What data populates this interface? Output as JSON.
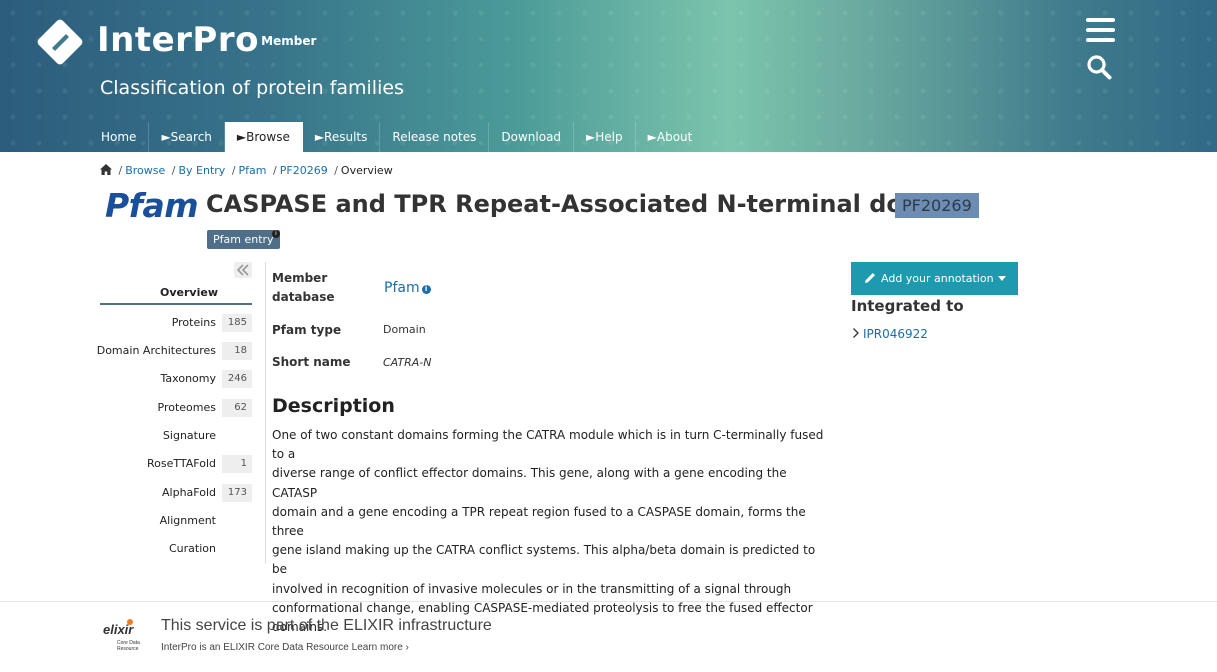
{
  "header": {
    "logo_text": "InterPro",
    "logo_sub": "- Member",
    "tagline": "Classification of protein families",
    "menu_icon": "hamburger-menu-icon",
    "search_icon": "search-icon"
  },
  "nav": {
    "items": [
      {
        "label": "Home"
      },
      {
        "label": "►Search"
      },
      {
        "label": "►Browse",
        "active": true
      },
      {
        "label": "►Results"
      },
      {
        "label": "Release notes"
      },
      {
        "label": "Download"
      },
      {
        "label": "►Help"
      },
      {
        "label": "►About"
      }
    ]
  },
  "breadcrumb": {
    "home_icon": "home-icon",
    "items": [
      "Browse",
      "By Entry",
      "Pfam",
      "PF20269"
    ],
    "current": "Overview"
  },
  "entry": {
    "db_logo": "Pfam",
    "title": "CASPASE and TPR Repeat-Associated N-terminal domain",
    "accession": "PF20269",
    "tag": "Pfam entry",
    "tag_info": "i"
  },
  "sidebar": {
    "overview": "Overview",
    "items": [
      {
        "label": "Proteins",
        "count": "185"
      },
      {
        "label": "Domain Architectures",
        "count": "18"
      },
      {
        "label": "Taxonomy",
        "count": "246"
      },
      {
        "label": "Proteomes",
        "count": "62"
      },
      {
        "label": "Signature",
        "count": ""
      },
      {
        "label": "RoseTTAFold",
        "count": "1"
      },
      {
        "label": "AlphaFold",
        "count": "173"
      },
      {
        "label": "Alignment",
        "count": ""
      },
      {
        "label": "Curation",
        "count": ""
      }
    ]
  },
  "details": {
    "member_db_label_1": "Member",
    "member_db_label_2": "database",
    "member_db_value": "Pfam",
    "member_db_info": "i",
    "type_label": "Pfam type",
    "type_value": "Domain",
    "short_name_label": "Short name",
    "short_name_value": "CATRA-N"
  },
  "description": {
    "heading": "Description",
    "lines": [
      "One of two constant domains forming the CATRA module which is in turn C-terminally fused to a",
      "diverse range of conflict effector domains. This gene, along with a gene encoding the CATASP",
      "domain and a gene encoding a TPR repeat region fused to a CASPASE domain, forms the three",
      "gene island making up the CATRA conflict systems. This alpha/beta domain is predicted to be",
      "involved in recognition of invasive molecules or in the transmitting of a signal through",
      "conformational change, enabling CASPASE-mediated proteolysis to free the fused effector",
      "domains."
    ]
  },
  "right_panel": {
    "annotation_button": "Add your annotation",
    "integrated_title": "Integrated to",
    "integrated_link": "IPR046922"
  },
  "footer": {
    "title": "This service is part of the ELIXIR infrastructure",
    "sub": "InterPro is an ELIXIR Core Data Resource Learn more ›",
    "logo_text": "elixir",
    "logo_sub_1": "Core Data",
    "logo_sub_2": "Resource"
  },
  "colors": {
    "accent": "#1e9aaf",
    "link": "#1a6ea8",
    "badge": "#6d8cb1",
    "pfam_blue": "#1a4f9c"
  }
}
